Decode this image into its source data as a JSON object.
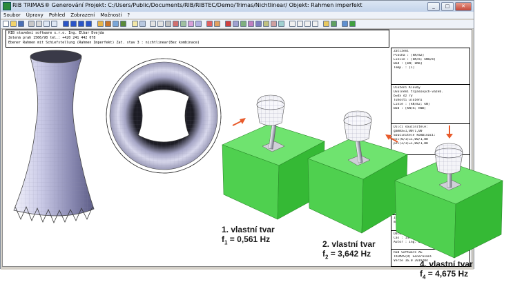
{
  "window": {
    "title": "RIB TRIMAS®  Generování  Projekt: C:/Users/Public/Documents/RIB/RIBTEC/Demo/Trimas/Nichtlinear/  Objekt: Rahmen imperfekt",
    "buttons": {
      "minimize": "_",
      "maximize": "□",
      "close": "✕"
    }
  },
  "menu": [
    "Soubor",
    "Úpravy",
    "Pohled",
    "Zobrazení",
    "Možnosti",
    "?"
  ],
  "header": {
    "line1": "RIB stavební software s.r.o.     Ing. Elbar Dvejda",
    "line2": "Zelená prah 1566/98                  tel.: +420 241 442 078",
    "line3": "Ebener Rahmen mit Schiefstellung (Rahmen Imperfekt)        Zat. stav 3 : nichtlinear(Bez kombinace)"
  },
  "legend": {
    "sec1": [
      "Zatížení",
      "Plocha     : [kN/m2]",
      "Liniie     : [kN/m; kNm/m]",
      "Bod        : [kN; kNm]",
      "Temp.      : [C]"
    ],
    "sec2": [
      "Uložení  Klouby",
      "Uvolnění trpasových-vazeb.",
      "b=dx   dz   ry",
      "Tuhosti uložení",
      "Linie      : [kN/m2; kN]",
      "Bod        : [kN/m; kNm]"
    ],
    "sec3": [
      "Dílčí součinitelé:",
      "gamma=1,00/1,00",
      "Součinitele kombinací:",
      "psi(0/1)=1,00/1,00",
      "psi(2/1)=1,00/1,00"
    ],
    "sec4": [
      "Impe...",
      "mit..."
    ],
    "sec5": [
      "Datum  : 18.01.2018",
      "Čas    : 14:04",
      "Autor  : Ing. Dvejda"
    ],
    "sec6": [
      "RIB Software AG",
      "TRIMAS(R)  Generování",
      "Verze 16.0  2019204"
    ]
  },
  "modes": [
    {
      "title": "1. vlastní tvar",
      "f_sub": "1",
      "f_value": "= 0,561 Hz"
    },
    {
      "title": "2. vlastní tvar",
      "f_sub": "2",
      "f_value": "= 3,642 Hz"
    },
    {
      "title": "4. vlastní tvar",
      "f_sub": "4",
      "f_value": "= 4,675 Hz"
    }
  ],
  "freq_symbol": "f",
  "colors": {
    "arrow": "#e85a2a",
    "block_top": "#6fe36f",
    "block_side": "#35b935",
    "block_front": "#4fd04f",
    "tower": "#c9c9e6"
  }
}
